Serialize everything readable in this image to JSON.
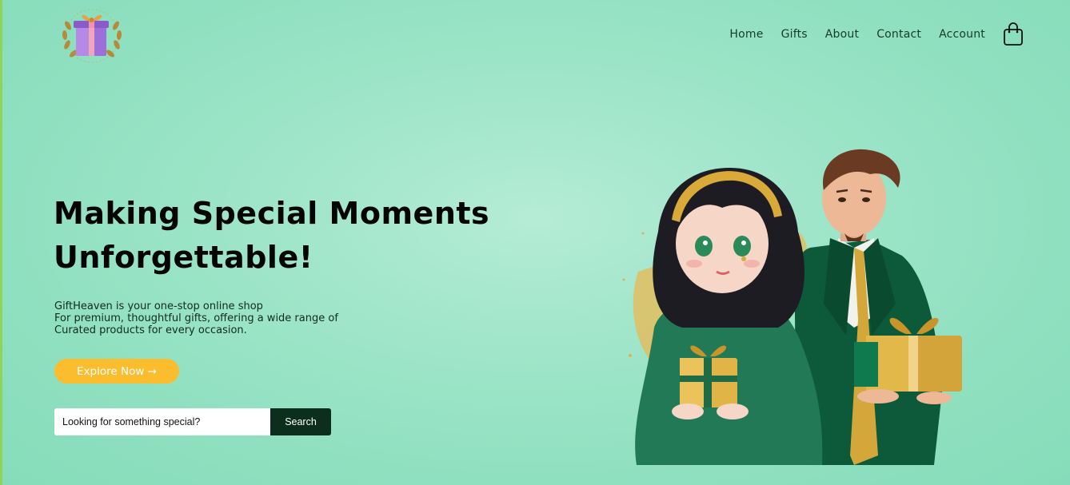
{
  "nav": {
    "items": [
      "Home",
      "Gifts",
      "About",
      "Contact",
      "Account"
    ]
  },
  "hero": {
    "title_line1": "Making Special Moments",
    "title_line2": "Unforgettable!",
    "desc_line1": "GiftHeaven is your one-stop online shop",
    "desc_line2": "For premium, thoughtful gifts, offering a wide range of",
    "desc_line3": "Curated products for every occasion.",
    "cta_label": "Explore Now →"
  },
  "search": {
    "placeholder": "Looking for something special?",
    "button_label": "Search"
  },
  "icons": {
    "logo": "gift-box-laurel-logo",
    "cart": "shopping-bag-icon"
  },
  "colors": {
    "background": "#a2e6cb",
    "accent": "#fbbd2e",
    "dark_green": "#0c2e1c"
  }
}
